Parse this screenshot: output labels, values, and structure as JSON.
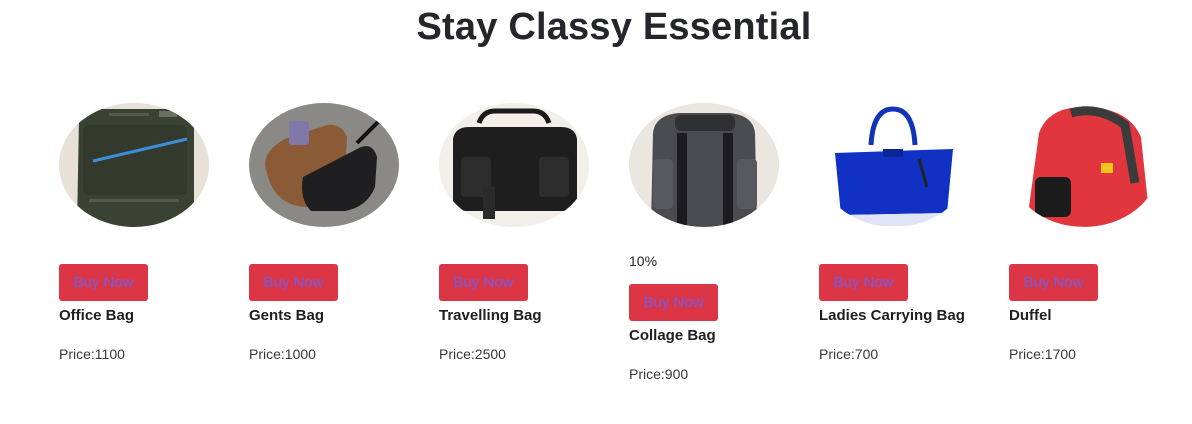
{
  "page": {
    "title": "Stay Classy Essential"
  },
  "products": [
    {
      "name": "Office Bag",
      "price": "Price:1100",
      "button": "Buy Now",
      "discount": "",
      "image": "office-bag-image"
    },
    {
      "name": "Gents Bag",
      "price": "Price:1000",
      "button": "Buy Now",
      "discount": "",
      "image": "gents-bag-image"
    },
    {
      "name": "Travelling Bag",
      "price": "Price:2500",
      "button": "Buy Now",
      "discount": "",
      "image": "travelling-bag-image"
    },
    {
      "name": "Collage Bag",
      "price": "Price:900",
      "button": "Buy Now",
      "discount": "10%",
      "image": "collage-bag-image"
    },
    {
      "name": "Ladies Carrying Bag",
      "price": "Price:700",
      "button": "Buy Now",
      "discount": "",
      "image": "ladies-bag-image"
    },
    {
      "name": "Duffel",
      "price": "Price:1700",
      "button": "Buy Now",
      "discount": "",
      "image": "duffel-bag-image"
    }
  ],
  "colors": {
    "button_bg": "#dc3545",
    "button_text": "#6f5ce6"
  }
}
